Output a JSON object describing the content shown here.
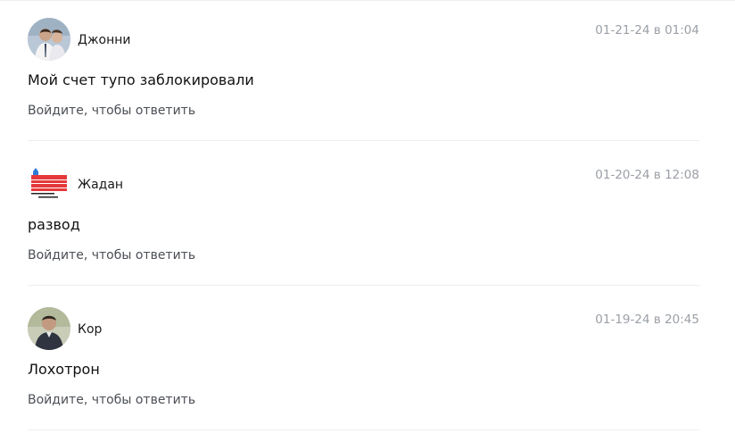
{
  "comments": [
    {
      "author": "Джонни",
      "date": "01-21-24 в 01:04",
      "text": "Мой счет тупо заблокировали",
      "reply_label": "Войдите, чтобы ответить",
      "avatar_icon": "photo-avatar"
    },
    {
      "author": "Жадан",
      "date": "01-20-24 в 12:08",
      "text": "развод",
      "reply_label": "Войдите, чтобы ответить",
      "avatar_icon": "logo-avatar"
    },
    {
      "author": "Кор",
      "date": "01-19-24 в 20:45",
      "text": "Лохотрон",
      "reply_label": "Войдите, чтобы ответить",
      "avatar_icon": "photo-avatar"
    }
  ]
}
